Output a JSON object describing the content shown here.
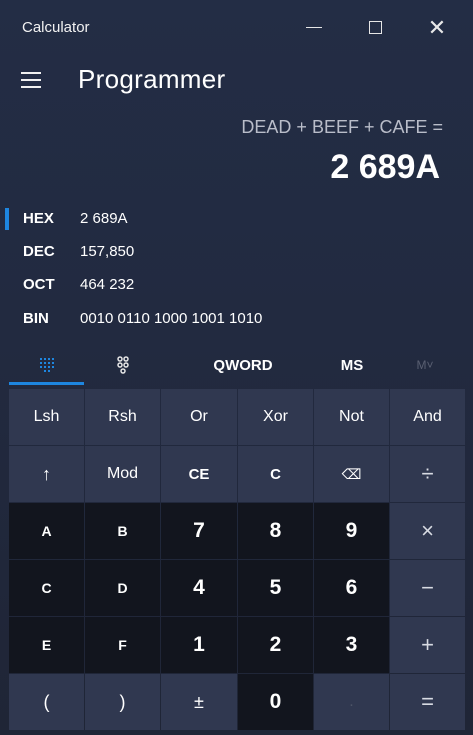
{
  "window": {
    "title": "Calculator"
  },
  "header": {
    "mode": "Programmer"
  },
  "display": {
    "expression": "DEAD + BEEF + CAFE =",
    "result": "2 689A"
  },
  "radix": [
    {
      "name": "HEX",
      "value": "2 689A",
      "selected": true
    },
    {
      "name": "DEC",
      "value": "157,850",
      "selected": false
    },
    {
      "name": "OCT",
      "value": "464 232",
      "selected": false
    },
    {
      "name": "BIN",
      "value": "0010 0110 1000 1001 1010",
      "selected": false
    }
  ],
  "tabs": {
    "word_size": "QWORD",
    "memory_store": "MS",
    "memory_recall": "M˅"
  },
  "keys": {
    "lsh": "Lsh",
    "rsh": "Rsh",
    "or": "Or",
    "xor": "Xor",
    "not": "Not",
    "and": "And",
    "up": "↑",
    "mod": "Mod",
    "ce": "CE",
    "c": "C",
    "backspace": "⌫",
    "divide": "÷",
    "a": "A",
    "b": "B",
    "seven": "7",
    "eight": "8",
    "nine": "9",
    "multiply": "×",
    "c_hex": "C",
    "d": "D",
    "four": "4",
    "five": "5",
    "six": "6",
    "minus": "−",
    "e": "E",
    "f": "F",
    "one": "1",
    "two": "2",
    "three": "3",
    "plus": "+",
    "open_paren": "(",
    "close_paren": ")",
    "negate": "±",
    "zero": "0",
    "decimal": ".",
    "equals": "="
  },
  "colors": {
    "accent": "#1e86e0"
  }
}
